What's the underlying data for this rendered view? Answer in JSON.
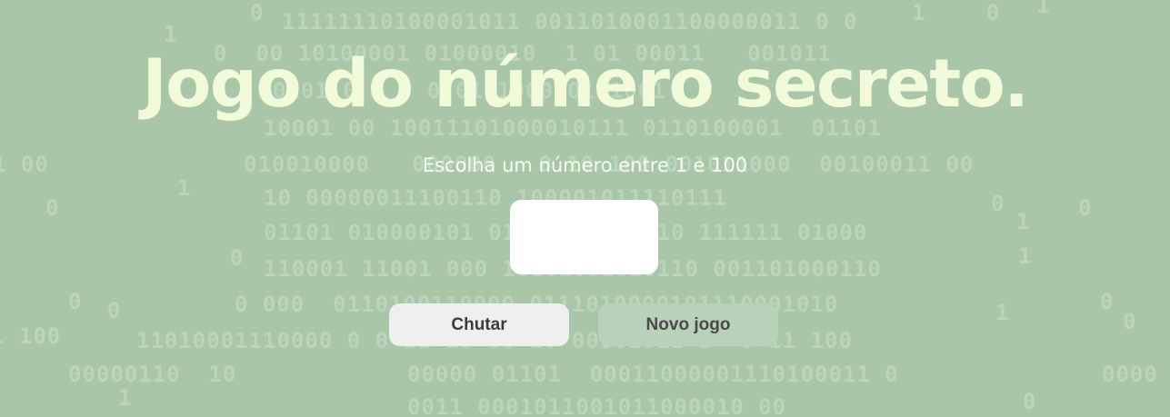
{
  "background_digits": [
    "0",
    "1",
    "1",
    "0",
    "1",
    "11111110100001011 0011010001100000011 0 0",
    "0  00 10100001 01000010  1 01 00011   001011",
    "0101 0 0 0 0 0101000101 1001",
    "10001 00 10011101000010111 0110100001  01101",
    "1 00",
    "010010000   000000   0 10 100 001011000  00100011 00",
    "1",
    "0",
    "10 00000011100110 100001011110111",
    "0",
    "1",
    "0",
    "01101 010000101 010 1100000010 111111 01000",
    "0",
    "110001 11001 000 10101001010110 001101000110",
    "1",
    "0",
    "0",
    "0 000  0110100110000 0111010000101110001010",
    "0",
    "0",
    "1",
    "1 100",
    "11010001110000 0 0 11 10 00 10 00001011 1  0 11 100",
    "00000110  10",
    "00000 01101  00011000001110100011 0",
    "0000",
    "1",
    "0011 0001011001011000010 00",
    "0"
  ],
  "title": "Jogo do número secreto.",
  "subtitle": "Escolha um número entre 1 e 100",
  "number_input": {
    "value": "",
    "placeholder": ""
  },
  "buttons": {
    "guess_label": "Chutar",
    "new_game_label": "Novo jogo"
  },
  "colors": {
    "background": "#a9c7a8",
    "title": "#f2fbd9",
    "button_active": "#efefef",
    "button_disabled": "#b9d1b8"
  }
}
